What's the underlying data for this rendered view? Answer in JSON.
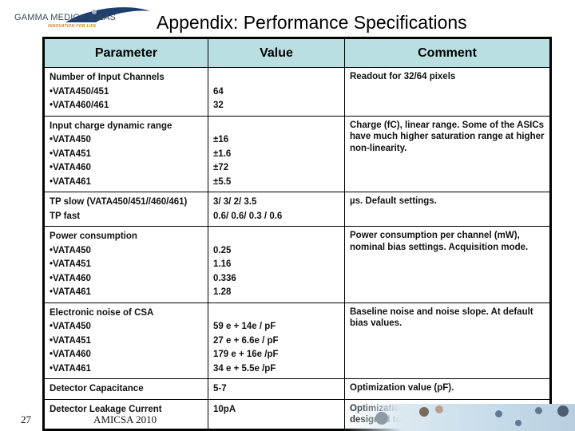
{
  "logo": {
    "name": "GAMMA MEDICA-IDEAS",
    "tagline": "INNOVATION FOR LIFE",
    "brand_color": "#1d3f6e",
    "tagline_color": "#c8822a"
  },
  "title": "Appendix: Performance Specifications",
  "table": {
    "header_color": "#b9dfe3",
    "headers": [
      "Parameter",
      "Value",
      "Comment"
    ],
    "rows": [
      {
        "parameter": [
          "Number of Input Channels",
          "•VATA450/451",
          "•VATA460/461"
        ],
        "value": [
          "",
          "64",
          "32"
        ],
        "comment": "Readout for 32/64 pixels"
      },
      {
        "parameter": [
          "Input charge dynamic range",
          "•VATA450",
          "•VATA451",
          "•VATA460",
          "•VATA461"
        ],
        "value": [
          "",
          "±16",
          "±1.6",
          "±72",
          "±5.5"
        ],
        "comment": "Charge (fC), linear range. Some of the ASICs have much higher saturation range at higher non-linearity."
      },
      {
        "parameter": [
          "TP slow (VATA450/451//460/461)",
          "TP fast"
        ],
        "value": [
          "3/ 3/ 2/ 3.5",
          "0.6/ 0.6/ 0.3 / 0.6"
        ],
        "comment": "µs. Default settings."
      },
      {
        "parameter": [
          "Power consumption",
          "•VATA450",
          "•VATA451",
          "•VATA460",
          "•VATA461"
        ],
        "value": [
          "",
          "0.25",
          "1.16",
          "0.336",
          "1.28"
        ],
        "comment": "Power consumption per channel (mW), nominal bias settings. Acquisition mode."
      },
      {
        "parameter": [
          "Electronic noise of CSA",
          "•VATA450",
          "•VATA451",
          "•VATA460",
          "•VATA461"
        ],
        "value": [
          "",
          "59 e  + 14e  / pF",
          "27 e  + 6.6e / pF",
          "179 e + 16e  /pF",
          "34 e  + 5.5e /pF"
        ],
        "comment": "Baseline noise and noise slope. At default bias values."
      },
      {
        "parameter": [
          "Detector Capacitance"
        ],
        "value": [
          "5-7"
        ],
        "comment": "Optimization value (pF)."
      },
      {
        "parameter": [
          "Detector Leakage Current"
        ],
        "value": [
          "10pA"
        ],
        "comment": "Optimization value. VATA460 has been designed to tolerate up to 36nA."
      }
    ]
  },
  "footer": {
    "slide_number": "27",
    "conference": "AMICSA 2010",
    "decor_image": "laboratory-science-photo-strip"
  }
}
